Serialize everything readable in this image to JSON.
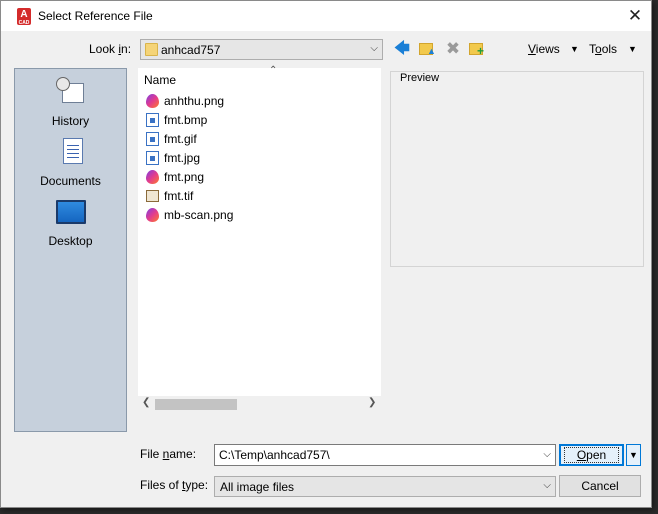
{
  "window": {
    "title": "Select Reference File",
    "app_icon_letter": "A",
    "app_icon_sub": "CAD",
    "close_glyph": "✕"
  },
  "toolbar": {
    "lookin_label_pre": "Look ",
    "lookin_label_key": "i",
    "lookin_label_post": "n:",
    "lookin_value": "anhcad757",
    "views_key": "V",
    "views_rest": "iews",
    "tools_pre": "T",
    "tools_key": "o",
    "tools_post": "ols",
    "icons": [
      "back-arrow-icon",
      "up-folder-icon",
      "delete-icon",
      "new-folder-icon"
    ]
  },
  "places": [
    {
      "label": "History",
      "icon": "history-icon"
    },
    {
      "label": "Documents",
      "icon": "documents-icon"
    },
    {
      "label": "Desktop",
      "icon": "desktop-icon"
    }
  ],
  "filelist": {
    "column_header": "Name",
    "files": [
      {
        "name": "anhthu.png",
        "icon": "png-icon"
      },
      {
        "name": "fmt.bmp",
        "icon": "image-icon"
      },
      {
        "name": "fmt.gif",
        "icon": "image-icon"
      },
      {
        "name": "fmt.jpg",
        "icon": "image-icon"
      },
      {
        "name": "fmt.png",
        "icon": "png-icon"
      },
      {
        "name": "fmt.tif",
        "icon": "tif-icon"
      },
      {
        "name": "mb-scan.png",
        "icon": "png-icon"
      }
    ]
  },
  "preview": {
    "label": "Preview"
  },
  "footer": {
    "filename_label_pre": "File ",
    "filename_label_key": "n",
    "filename_label_post": "ame:",
    "filename_value": "C:\\Temp\\anhcad757\\",
    "filetype_label_pre": "Files of ",
    "filetype_label_key": "t",
    "filetype_label_post": "ype:",
    "filetype_value": "All image files",
    "open_key": "O",
    "open_rest": "pen",
    "cancel_label": "Cancel"
  }
}
